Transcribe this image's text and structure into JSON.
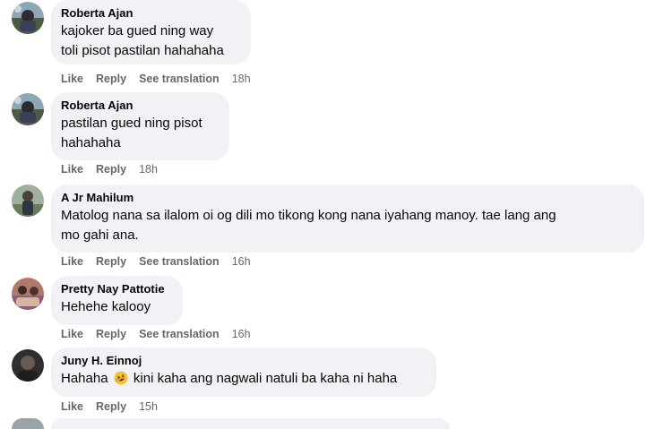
{
  "actions": {
    "like": "Like",
    "reply": "Reply",
    "see_translation": "See translation"
  },
  "comments": [
    {
      "author": "Roberta Ajan",
      "lines": [
        "kajoker ba gued ning way",
        "toli pisot pastilan hahahaha"
      ],
      "time": "18h",
      "has_translation": true,
      "avatar_icon": "profile-photo-avatar"
    },
    {
      "author": "Roberta Ajan",
      "lines": [
        "pastilan gued ning pisot",
        "hahahaha"
      ],
      "time": "18h",
      "has_translation": false,
      "avatar_icon": "profile-photo-avatar"
    },
    {
      "author": "A Jr Mahilum",
      "lines": [
        "Matolog nana sa ilalom oi og dili mo tikong kong nana iyahang manoy. tae lang ang",
        "mo gahi ana."
      ],
      "time": "16h",
      "has_translation": true,
      "avatar_icon": "profile-photo-avatar"
    },
    {
      "author": "Pretty Nay Pattotie",
      "lines": [
        "Hehehe kalooy"
      ],
      "time": "16h",
      "has_translation": true,
      "avatar_icon": "profile-photo-avatar"
    },
    {
      "author": "Juny H. Einnoj",
      "text_before_emoji": "Hahaha",
      "emoji": "rolling-on-floor-laughing-emoji",
      "text_after_emoji": "kini kaha ang nagwali natuli ba kaha ni haha",
      "time": "15h",
      "has_translation": false,
      "avatar_icon": "profile-photo-avatar"
    }
  ],
  "colors": {
    "bubble_bg": "#f0f2f5",
    "meta_text": "#65676b",
    "primary_text": "#050505"
  }
}
